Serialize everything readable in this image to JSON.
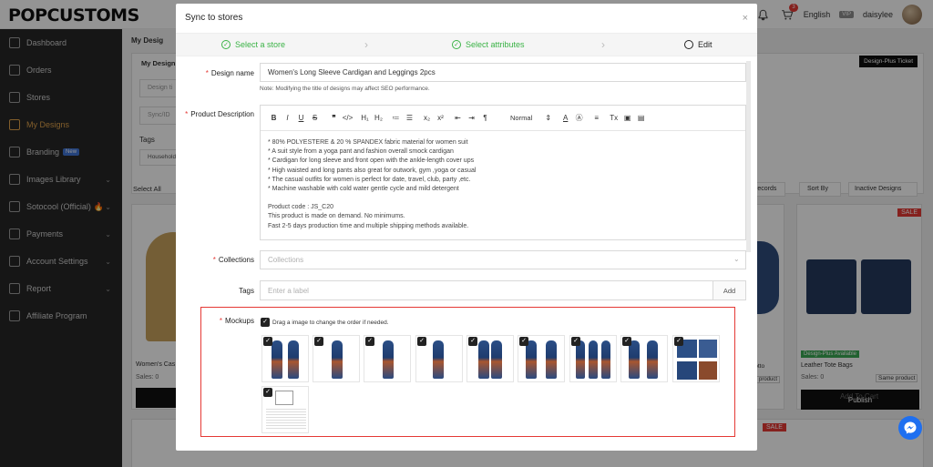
{
  "brand": {
    "logo": "POPCUSTOMS"
  },
  "header": {
    "notify_count": "3",
    "language": "English",
    "vip_label": "VIP",
    "username": "daisylee"
  },
  "sidebar": {
    "items": [
      {
        "label": "Dashboard"
      },
      {
        "label": "Orders"
      },
      {
        "label": "Stores"
      },
      {
        "label": "My Designs"
      },
      {
        "label": "Branding",
        "badge": "New"
      },
      {
        "label": "Images Library"
      },
      {
        "label": "Sotocool (Official)"
      },
      {
        "label": "Payments"
      },
      {
        "label": "Account Settings"
      },
      {
        "label": "Report"
      },
      {
        "label": "Affiliate Program"
      }
    ]
  },
  "background": {
    "breadcrumb": "My Desig",
    "tab": "My Designs",
    "design_title_placeholder": "Design ti",
    "sync_placeholder": "Sync/ID",
    "tags_label": "Tags",
    "tags_value": "Household",
    "select_all": "Select All",
    "records_btn": "records",
    "sort_btn": "Sort By",
    "inactive_btn": "Inactive Designs",
    "ticket_btn": "Design-Plus Ticket",
    "card1_name": "Women's Cas",
    "card1_sales": "Sales: 0",
    "card4_name": "cotto",
    "card4_same": "e product",
    "card5_name": "Leather Tote Bags",
    "card5_sales": "Sales: 0",
    "card5_same": "Same product",
    "card5_badge": "Design-Plus Available",
    "sale_badge": "SALE",
    "publish_label": "Publish",
    "add_to_cart": "Add To Cart"
  },
  "modal": {
    "title": "Sync to stores",
    "close": "×",
    "steps": [
      {
        "label": "Select a store",
        "state": "done"
      },
      {
        "label": "Select attributes",
        "state": "done"
      },
      {
        "label": "Edit",
        "state": "current"
      }
    ],
    "design_name_label": "Design name",
    "design_name_value": "Women's Long Sleeve Cardigan and Leggings 2pcs",
    "design_name_note": "Note: Modifying the title of designs may affect SEO performance.",
    "description_label": "Product Description",
    "toolbar_format": "Normal",
    "description_lines": [
      "* 80% POLYESTERE & 20 % SPANDEX fabric material for women suit",
      "* A suit style from a yoga pant and fashion overall smock cardigan",
      "* Cardigan for long sleeve and front open with the ankle-length cover ups",
      "* High waisted and long pants also great for outwork, gym ,yoga or casual",
      "* The casual outfits for women is perfect for date, travel, club, party ,etc.",
      "* Machine washable with cold water gentle cycle and mild detergent",
      "",
      "Product code : JS_C20",
      "This product is made on demand. No minimums.",
      "Fast 2-5 days production time and multiple shipping methods available."
    ],
    "collections_label": "Collections",
    "collections_placeholder": "Collections",
    "tags_label": "Tags",
    "tags_placeholder": "Enter a label",
    "tags_add": "Add",
    "mockups_label": "Mockups",
    "mockups_hint": "Drag a image to change the order if needed."
  }
}
